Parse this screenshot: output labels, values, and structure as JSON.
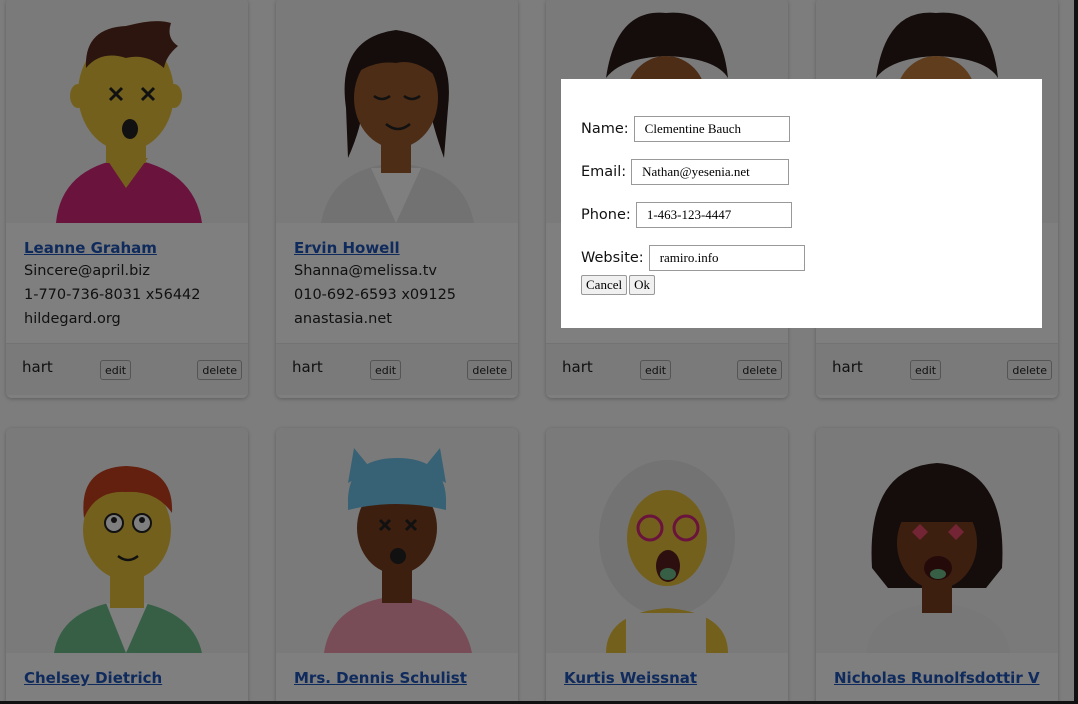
{
  "cards": [
    {
      "name": "Leanne Graham",
      "email": "Sincere@april.biz",
      "phone": "1-770-736-8031 x56442",
      "website": "hildegard.org",
      "tag": "hart",
      "edit": "edit",
      "delete": "delete"
    },
    {
      "name": "Ervin Howell",
      "email": "Shanna@melissa.tv",
      "phone": "010-692-6593 x09125",
      "website": "anastasia.net",
      "tag": "hart",
      "edit": "edit",
      "delete": "delete"
    },
    {
      "name": "",
      "email": "",
      "phone": "",
      "website": "",
      "tag": "hart",
      "edit": "edit",
      "delete": "delete"
    },
    {
      "name": "",
      "email": "",
      "phone": "",
      "website": "",
      "tag": "hart",
      "edit": "edit",
      "delete": "delete"
    },
    {
      "name": "Chelsey Dietrich",
      "email": "",
      "phone": "",
      "website": ""
    },
    {
      "name": "Mrs. Dennis Schulist",
      "email": "",
      "phone": "",
      "website": ""
    },
    {
      "name": "Kurtis Weissnat",
      "email": "",
      "phone": "",
      "website": ""
    },
    {
      "name": "Nicholas Runolfsdottir V",
      "email": "",
      "phone": "",
      "website": ""
    }
  ],
  "modal": {
    "name_label": "Name:",
    "name_value": "Clementine Bauch",
    "email_label": "Email:",
    "email_value": "Nathan@yesenia.net",
    "phone_label": "Phone:",
    "phone_value": "1-463-123-4447",
    "website_label": "Website:",
    "website_value": "ramiro.info",
    "cancel_label": "Cancel",
    "ok_label": "Ok"
  },
  "colors": {
    "link": "#1f55b8",
    "overlay": "rgba(0,0,0,0.5)",
    "skin_yellow": "#e8c13a",
    "skin_brown": "#9a5a2c",
    "shirt_magenta": "#d4267a",
    "cap_blue": "#6fc3e8"
  },
  "avatars": [
    "dizzy-man",
    "smiling-woman",
    "curly-woman",
    "curly-woman-2",
    "red-hair-man",
    "blue-cap-boy",
    "glasses-girl",
    "heart-eyes-woman"
  ]
}
